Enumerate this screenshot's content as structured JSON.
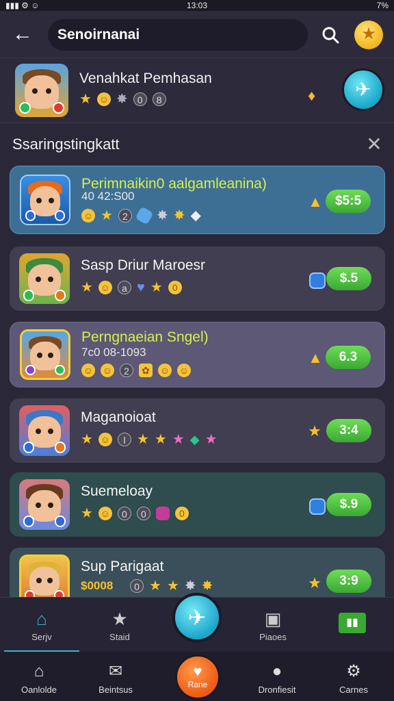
{
  "status": {
    "time": "13:03",
    "battery": "7%"
  },
  "topbar": {
    "search_value": "Senoirnanai"
  },
  "featured": {
    "title": "Venahkat Pemhasan"
  },
  "section": {
    "title": "Ssaringstingkatt"
  },
  "items": [
    {
      "name": "Perimnaikin0 aalgamleanina)",
      "sub": "40 42:S00",
      "price": "$5:5"
    },
    {
      "name": "Sasp Driur Maroesr",
      "price": "$.5"
    },
    {
      "name": "Perngnaeian Sngel)",
      "sub": "7c0 08-1093",
      "price": "6.3"
    },
    {
      "name": "Maganoioat",
      "price": "3:4"
    },
    {
      "name": "Suemeloay",
      "price": "$.9"
    },
    {
      "name": "Sup Parigaat",
      "sub": "$0008",
      "price": "3:9"
    }
  ],
  "nav1": {
    "items": [
      {
        "label": "Serjv"
      },
      {
        "label": "Staid"
      },
      {
        "label": "Piaoes"
      },
      {
        "label": ""
      }
    ]
  },
  "nav2": {
    "items": [
      {
        "label": "Oanlolde"
      },
      {
        "label": "Beintsus"
      },
      {
        "label": "Rane"
      },
      {
        "label": "Dronfiesit"
      },
      {
        "label": "Carnes"
      }
    ]
  },
  "colors": {
    "accent": "#1ca6cc",
    "price": "#3aa932",
    "card_blue": "#3d6f95",
    "card_purple": "#5c5875"
  }
}
